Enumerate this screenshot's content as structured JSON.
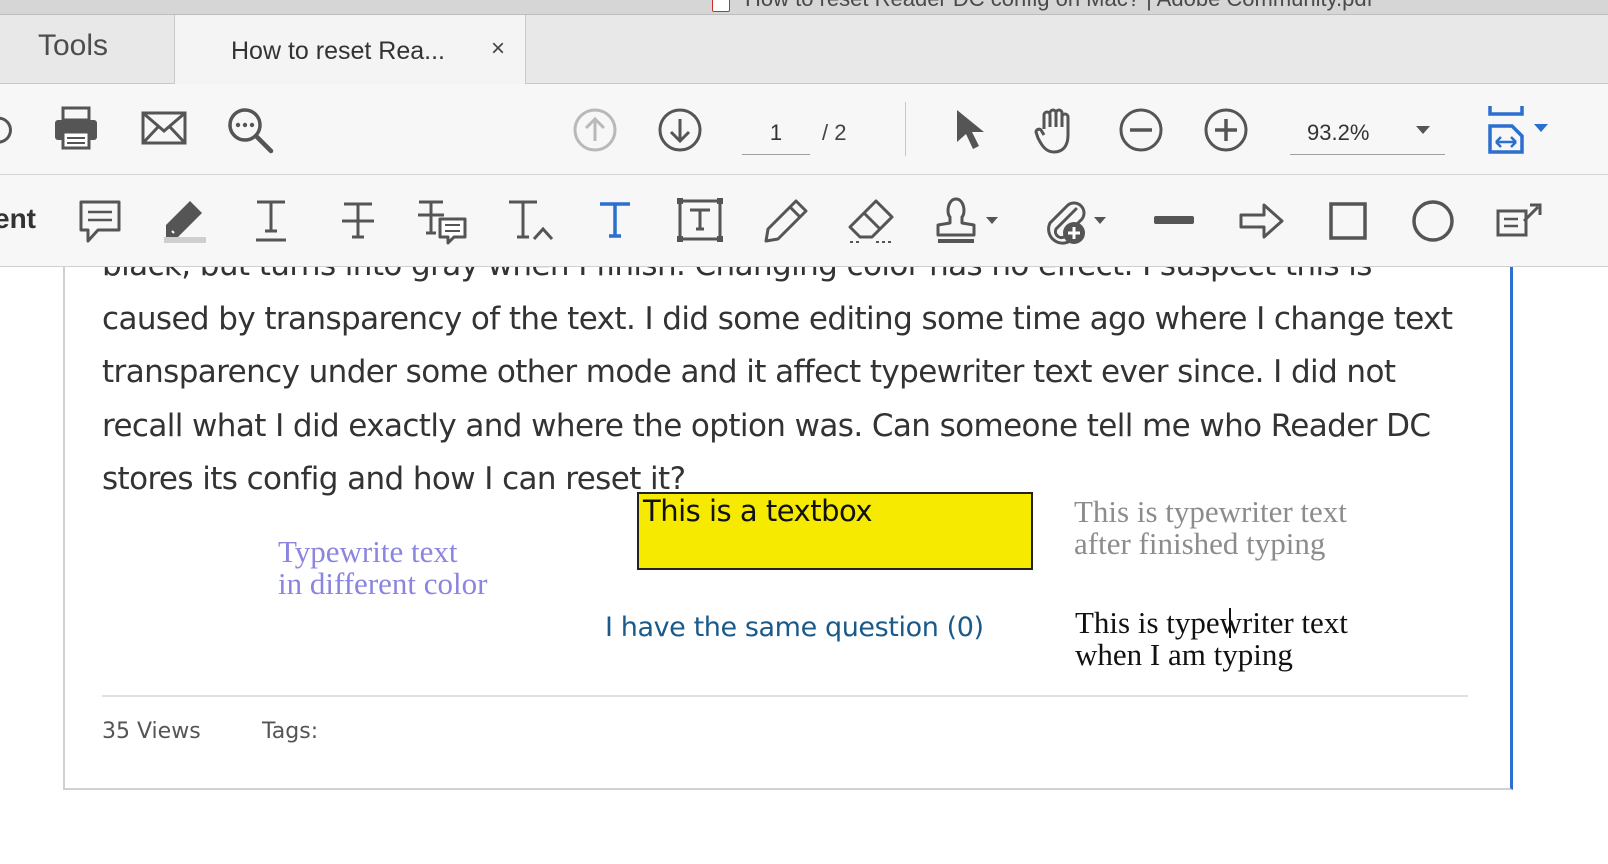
{
  "window": {
    "title_partial": "How to reset Reader DC config on Mac? | Adobe Community.pdf"
  },
  "tabs": {
    "tools_label": "Tools",
    "document_label": "How to reset Rea...",
    "close_glyph": "×"
  },
  "toolbar": {
    "icons": [
      "undo-icon",
      "print-icon",
      "email-icon",
      "search-icon",
      "page-up-icon",
      "page-down-icon",
      "select-arrow-icon",
      "hand-icon",
      "zoom-out-icon",
      "zoom-in-icon",
      "fit-page-icon"
    ],
    "page_current": "1",
    "page_total": "/ 2",
    "zoom_value": "93.2%"
  },
  "comment_toolbar": {
    "cut_label": "ent",
    "icons": [
      "sticky-note-icon",
      "highlight-icon",
      "underline-text-icon",
      "strikethrough-icon",
      "replace-text-icon",
      "insert-text-icon",
      "typewriter-icon",
      "text-box-icon",
      "pencil-icon",
      "eraser-icon",
      "stamp-icon",
      "attach-file-icon",
      "line-icon",
      "arrow-icon",
      "rectangle-icon",
      "oval-icon",
      "more-tools-icon"
    ]
  },
  "document": {
    "post_text": "black, but turns into gray when I finish. Changing color has no effect. I suspect this is caused by transparency of the text. I did some editing some time ago where I change text transparency under some other mode and it affect typewriter text ever since. I did not recall what I did exactly and where the option was. Can someone tell me who Reader DC stores its config and how I can reset it?",
    "typewriter_colored": "Typewrite text\nin different color",
    "textbox_text": "This is a textbox",
    "typewriter_finished": "This is typewriter text\nafter finished typing",
    "typewriter_active": "This is typewriter text\nwhen I am typing",
    "same_question_link": "I have the same question (0)",
    "views": "35 Views",
    "tags": "Tags:",
    "colors": {
      "typewriter_colored": "#8a85e0",
      "textbox_fill": "#f6ea00",
      "typewriter_gray": "#8c8c8c",
      "link": "#1a5a8a",
      "accent_blue": "#2b6fcf"
    }
  }
}
